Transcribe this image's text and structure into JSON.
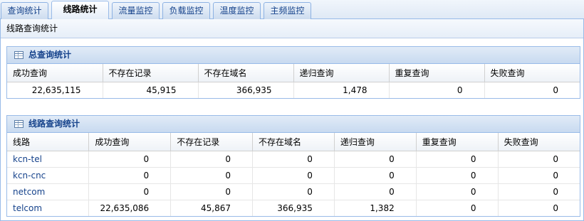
{
  "tabs": [
    {
      "label": "查询统计",
      "active": false
    },
    {
      "label": "线路统计",
      "active": true
    },
    {
      "label": "流量监控",
      "active": false
    },
    {
      "label": "负载监控",
      "active": false
    },
    {
      "label": "温度监控",
      "active": false
    },
    {
      "label": "主频监控",
      "active": false
    }
  ],
  "page_title": "线路查询统计",
  "total": {
    "title": "总查询统计",
    "columns": [
      "成功查询",
      "不存在记录",
      "不存在域名",
      "递归查询",
      "重复查询",
      "失败查询"
    ],
    "values": [
      "22,635,115",
      "45,915",
      "366,935",
      "1,478",
      "0",
      "0"
    ]
  },
  "lines": {
    "title": "线路查询统计",
    "columns": [
      "线路",
      "成功查询",
      "不存在记录",
      "不存在域名",
      "递归查询",
      "重复查询",
      "失败查询"
    ],
    "rows": [
      [
        "kcn-tel",
        "0",
        "0",
        "0",
        "0",
        "0",
        "0"
      ],
      [
        "kcn-cnc",
        "0",
        "0",
        "0",
        "0",
        "0",
        "0"
      ],
      [
        "netcom",
        "0",
        "0",
        "0",
        "0",
        "0",
        "0"
      ],
      [
        "telcom",
        "22,635,086",
        "45,867",
        "366,935",
        "1,382",
        "0",
        "0"
      ]
    ]
  },
  "colors": {
    "accent": "#15428b",
    "border": "#99bbe8",
    "header_bg": "#dfe9f5"
  },
  "icons": {
    "grid": "grid-table-icon"
  }
}
